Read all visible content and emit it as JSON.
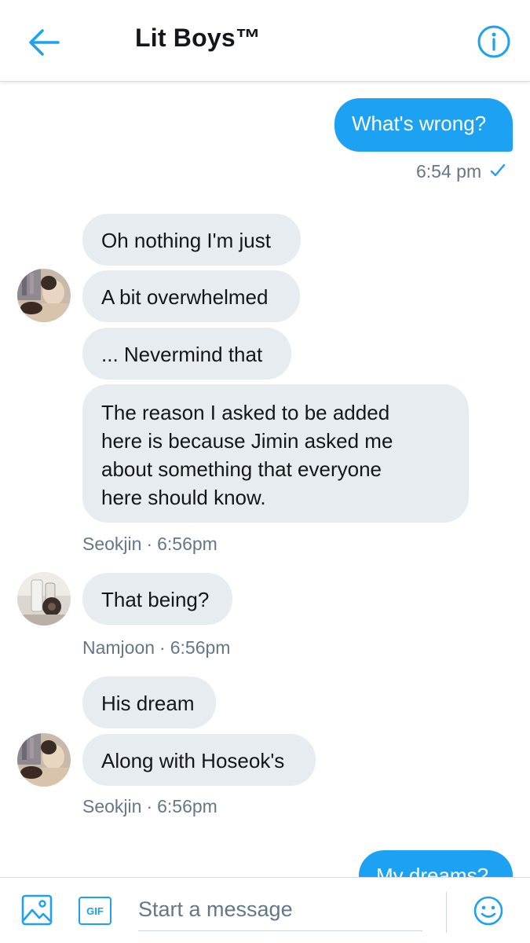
{
  "header": {
    "title": "Lit Boys™",
    "back_icon": "arrow-left-icon",
    "info_icon": "info-icon",
    "accent_color": "#1da1f2"
  },
  "messages": {
    "m1": {
      "text": "What's wrong?",
      "time": "6:54 pm"
    },
    "group1": {
      "b1": "Oh nothing I'm just",
      "b2": "A bit overwhelmed",
      "b3": "... Nevermind that",
      "b4_l1": "The reason I asked to be added",
      "b4_l2": "here is because Jimin asked me",
      "b4_l3": "about something that everyone",
      "b4_l4": "here should know.",
      "sender": "Seokjin",
      "time": "6:56pm"
    },
    "group2": {
      "b1": "That being?",
      "sender": "Namjoon",
      "time": "6:56pm"
    },
    "group3": {
      "b1": "His dream",
      "b2": "Along with Hoseok's",
      "sender": "Seokjin",
      "time": "6:56pm"
    },
    "m_last": {
      "text": "My dreams?"
    }
  },
  "composer": {
    "placeholder": "Start a message",
    "gif_label": "GIF",
    "media_icon": "image-icon",
    "emoji_icon": "emoji-icon"
  },
  "colors": {
    "sent_bubble": "#1da1f2",
    "received_bubble": "#e6ecf0",
    "meta_text": "#657786"
  }
}
